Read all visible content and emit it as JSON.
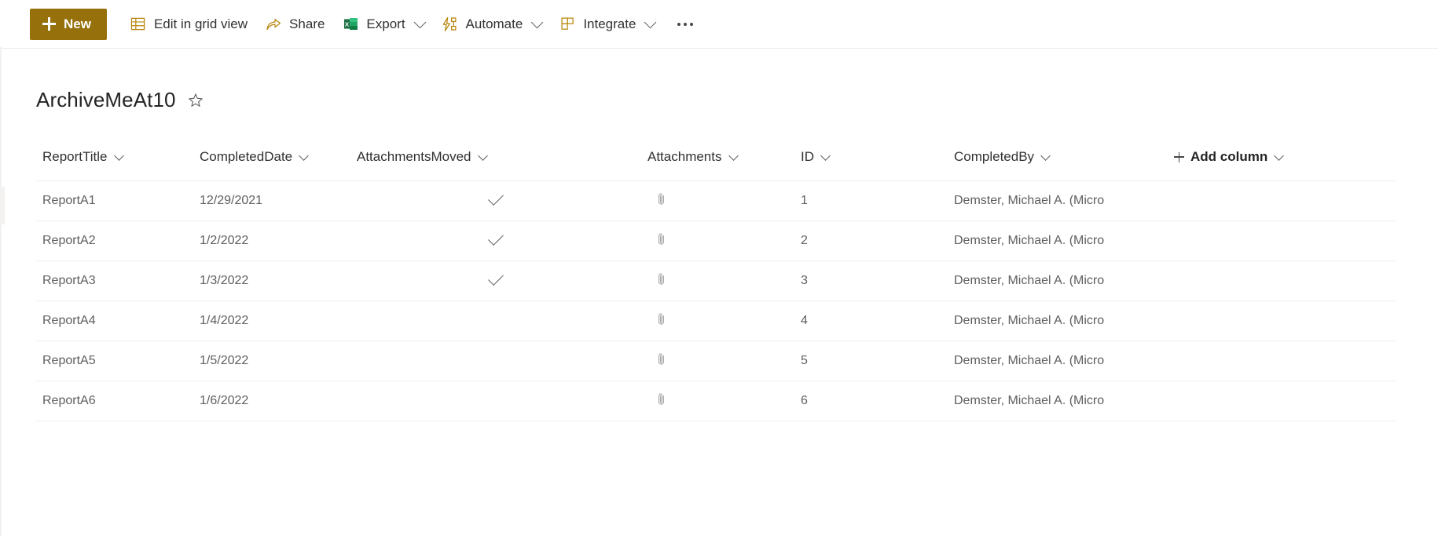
{
  "commandbar": {
    "new_label": "New",
    "items": [
      {
        "label": "Edit in grid view",
        "icon": "grid-view-icon",
        "has_chevron": false
      },
      {
        "label": "Share",
        "icon": "share-icon",
        "has_chevron": false
      },
      {
        "label": "Export",
        "icon": "excel-icon",
        "has_chevron": true
      },
      {
        "label": "Automate",
        "icon": "automate-flow-icon",
        "has_chevron": true
      },
      {
        "label": "Integrate",
        "icon": "integrate-icon",
        "has_chevron": true
      }
    ],
    "overflow_label": "More options",
    "accent_color": "#96700b"
  },
  "header": {
    "title": "ArchiveMeAt10",
    "favorite_icon": "star-outline-icon"
  },
  "table": {
    "columns": [
      {
        "label": "ReportTitle",
        "key": "title"
      },
      {
        "label": "CompletedDate",
        "key": "date"
      },
      {
        "label": "AttachmentsMoved",
        "key": "moved"
      },
      {
        "label": "Attachments",
        "key": "attachments"
      },
      {
        "label": "ID",
        "key": "id"
      },
      {
        "label": "CompletedBy",
        "key": "completedby"
      }
    ],
    "add_column_label": "Add column",
    "rows": [
      {
        "title": "ReportA1",
        "date": "12/29/2021",
        "moved": true,
        "attachment_icon": "paperclip-icon",
        "id": "1",
        "completedby": "Demster, Michael A. (Micro"
      },
      {
        "title": "ReportA2",
        "date": "1/2/2022",
        "moved": true,
        "attachment_icon": "paperclip-icon",
        "id": "2",
        "completedby": "Demster, Michael A. (Micro"
      },
      {
        "title": "ReportA3",
        "date": "1/3/2022",
        "moved": true,
        "attachment_icon": "paperclip-icon",
        "id": "3",
        "completedby": "Demster, Michael A. (Micro"
      },
      {
        "title": "ReportA4",
        "date": "1/4/2022",
        "moved": false,
        "attachment_icon": "paperclip-icon",
        "id": "4",
        "completedby": "Demster, Michael A. (Micro"
      },
      {
        "title": "ReportA5",
        "date": "1/5/2022",
        "moved": false,
        "attachment_icon": "paperclip-icon",
        "id": "5",
        "completedby": "Demster, Michael A. (Micro"
      },
      {
        "title": "ReportA6",
        "date": "1/6/2022",
        "moved": false,
        "attachment_icon": "paperclip-icon",
        "id": "6",
        "completedby": "Demster, Michael A. (Micro"
      }
    ]
  }
}
